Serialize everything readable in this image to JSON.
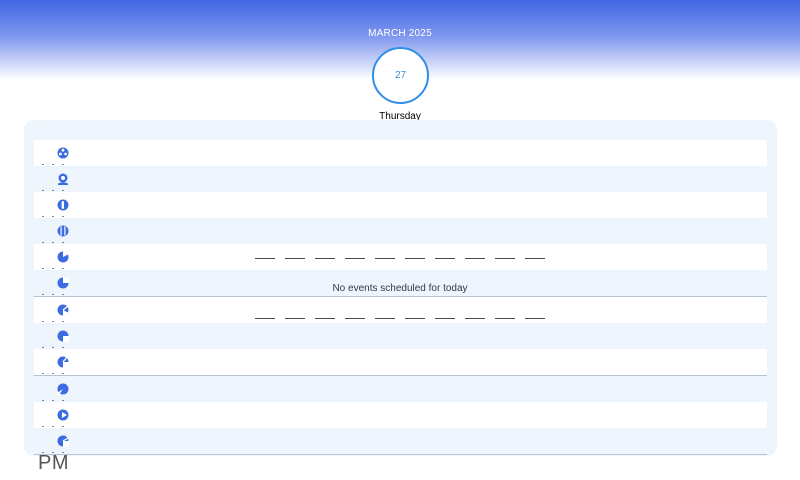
{
  "header": {
    "month_year": "MARCH 2025",
    "day_number": "27",
    "weekday": "Thursday"
  },
  "schedule": {
    "empty_message": "No events scheduled for today",
    "period_label": "PM",
    "hour_rows": 12
  },
  "colors": {
    "header_gradient_top": "#4166e4",
    "accent_blue": "#2f8fe6",
    "icon_blue": "#3d6be0",
    "panel_background": "#eef5fd"
  },
  "icons": [
    "clock-icon",
    "location-icon",
    "clock-icon"
  ]
}
